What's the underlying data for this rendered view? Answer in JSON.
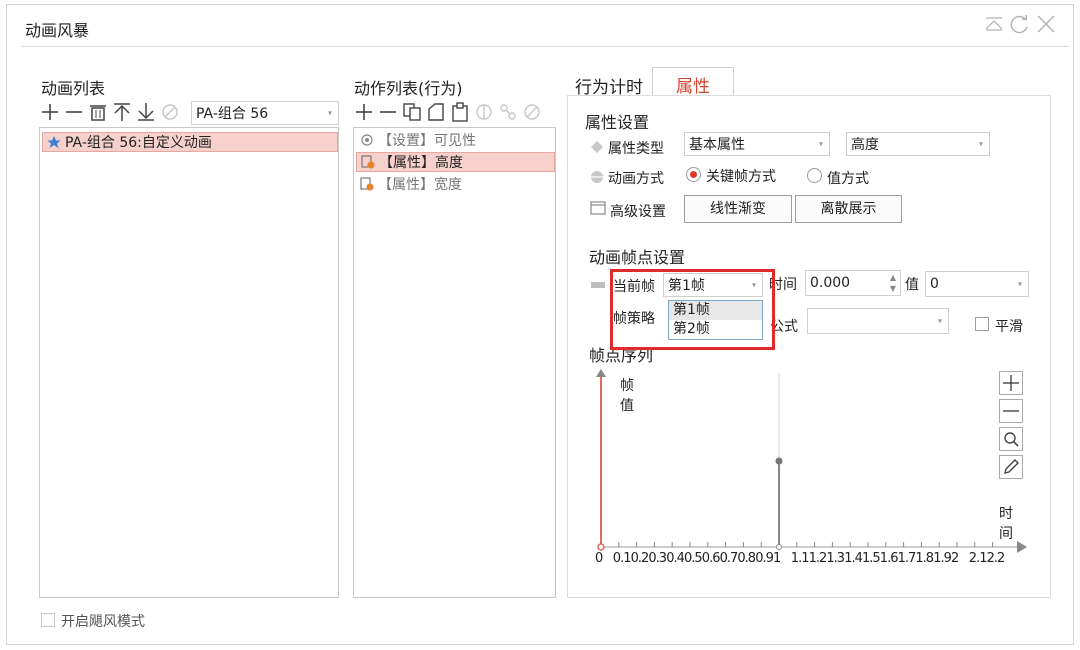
{
  "window": {
    "title": "动画风暴",
    "footer_checkbox_label": "开启飓风模式"
  },
  "anim_list": {
    "title": "动画列表",
    "combo_value": "PA-组合 56",
    "items": [
      {
        "label": "PA-组合 56:自定义动画",
        "selected": true
      }
    ]
  },
  "action_list": {
    "title": "动作列表(行为)",
    "items": [
      {
        "label": "【设置】可见性",
        "selected": false
      },
      {
        "label": "【属性】高度",
        "selected": true
      },
      {
        "label": "【属性】宽度",
        "selected": false
      }
    ]
  },
  "tabs": [
    {
      "label": "行为计时",
      "active": false
    },
    {
      "label": "属性",
      "active": true
    }
  ],
  "props": {
    "section_title": "属性设置",
    "type_label": "属性类型",
    "type_value": "基本属性",
    "attr_value": "高度",
    "mode_label": "动画方式",
    "mode_options": [
      "关键帧方式",
      "值方式"
    ],
    "mode_selected": "关键帧方式",
    "advanced_label": "高级设置",
    "btn_linear": "线性渐变",
    "btn_discrete": "离散展示"
  },
  "keyframe": {
    "section_title": "动画帧点设置",
    "current_label": "当前帧",
    "current_value": "第1帧",
    "time_label": "时间",
    "time_value": "0.000",
    "value_label": "值",
    "value_value": "0",
    "strategy_label": "帧策略",
    "formula_label": "公式",
    "formula_value": "",
    "smooth_label": "平滑",
    "dropdown_options": [
      "第1帧",
      "第2帧"
    ],
    "dropdown_hover": "第1帧"
  },
  "sequence": {
    "section_title": "帧点序列",
    "y_label_1": "帧",
    "y_label_2": "值",
    "x_label": [
      "时",
      "间"
    ],
    "x_ticks": [
      "0",
      "0.1",
      "0.2",
      "0.3",
      "0.4",
      "0.5",
      "0.6",
      "0.7",
      "0.8",
      "0.9",
      "1",
      "1.1",
      "1.2",
      "1.3",
      "1.4",
      "1.5",
      "1.6",
      "1.7",
      "1.8",
      "1.9",
      "2",
      "2.1",
      "2.2"
    ]
  },
  "colors": {
    "accent": "#d9442f",
    "selection": "#f6d1cc",
    "highlight": "#e12a2a"
  }
}
